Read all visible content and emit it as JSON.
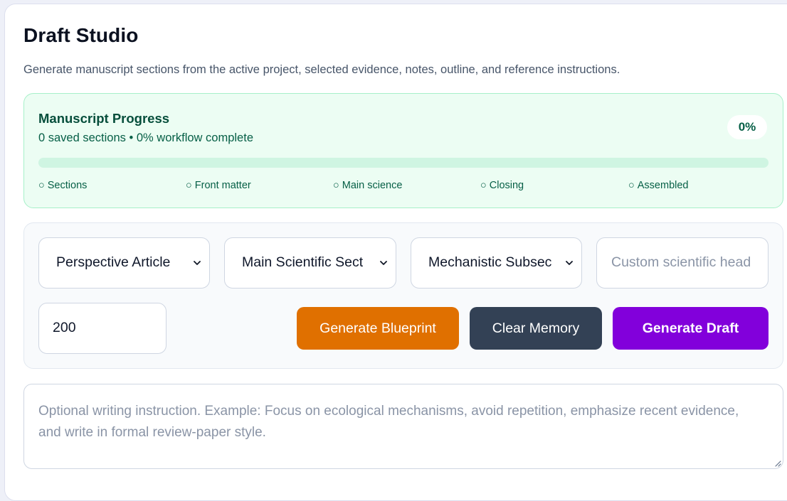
{
  "header": {
    "title": "Draft Studio",
    "subtitle": "Generate manuscript sections from the active project, selected evidence, notes, outline, and reference instructions."
  },
  "progress": {
    "title": "Manuscript Progress",
    "summary": "0 saved sections • 0% workflow complete",
    "percent_label": "0%",
    "percent_value": 0,
    "fill_color": "#10b981",
    "milestones": [
      {
        "label": "Sections",
        "done": false
      },
      {
        "label": "Front matter",
        "done": false
      },
      {
        "label": "Main science",
        "done": false
      },
      {
        "label": "Closing",
        "done": false
      },
      {
        "label": "Assembled",
        "done": false
      }
    ],
    "milestone_marker": "○"
  },
  "controls": {
    "article_type": {
      "value": "Perspective Article"
    },
    "section_group": {
      "value": "Main Scientific Sect"
    },
    "subsection": {
      "value": "Mechanistic Subsec"
    },
    "custom_heading": {
      "placeholder": "Custom scientific head"
    },
    "word_count": {
      "value": "200"
    },
    "buttons": {
      "blueprint": {
        "label": "Generate Blueprint",
        "color": "#e07000"
      },
      "clear": {
        "label": "Clear Memory",
        "color": "#334155"
      },
      "draft": {
        "label": "Generate Draft",
        "color": "#8200db"
      }
    }
  },
  "instruction": {
    "placeholder": "Optional writing instruction. Example: Focus on ecological mechanisms, avoid repetition, emphasize recent evidence, and write in formal review-paper style."
  },
  "icons": {
    "select_arrow": "chevron-down-icon",
    "resize": "resize-handle-icon"
  }
}
